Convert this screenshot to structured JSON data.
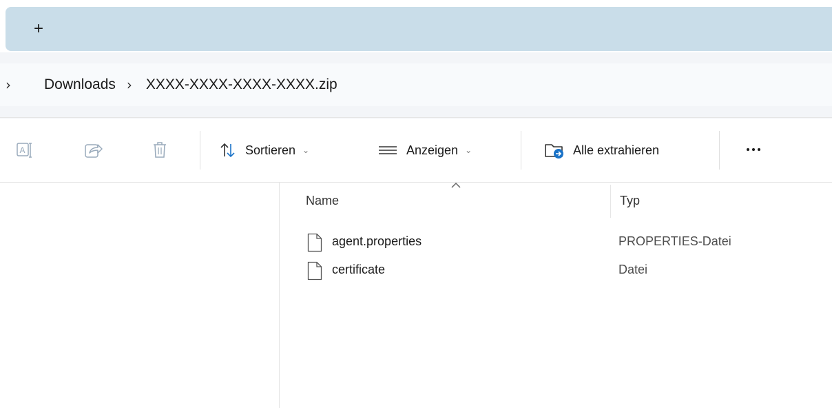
{
  "tabbar": {
    "new_tab_glyph": "+"
  },
  "breadcrumb": {
    "separator": "›",
    "items": [
      "Downloads",
      "XXXX-XXXX-XXXX-XXXX.zip"
    ]
  },
  "toolbar": {
    "icons": [
      "rename-icon",
      "share-icon",
      "delete-icon"
    ],
    "sort_label": "Sortieren",
    "view_label": "Anzeigen",
    "extract_label": "Alle extrahieren",
    "chevron": "⌄",
    "accent": "#1a73c8"
  },
  "columns": {
    "name": "Name",
    "type": "Typ"
  },
  "files": [
    {
      "name": "agent.properties",
      "type": "PROPERTIES-Datei",
      "icon": "file-icon"
    },
    {
      "name": "certificate",
      "type": "Datei",
      "icon": "file-icon"
    }
  ]
}
